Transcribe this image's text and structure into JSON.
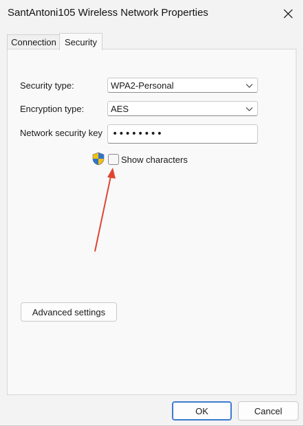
{
  "window": {
    "title": "SantAntoni105 Wireless Network Properties",
    "close_icon": "close-icon"
  },
  "tabs": [
    {
      "label": "Connection",
      "active": false
    },
    {
      "label": "Security",
      "active": true
    }
  ],
  "security": {
    "security_type_label": "Security type:",
    "security_type_value": "WPA2-Personal",
    "encryption_type_label": "Encryption type:",
    "encryption_type_value": "AES",
    "network_key_label": "Network security key",
    "network_key_value": "••••••••",
    "show_characters_label": "Show characters",
    "show_characters_checked": false,
    "shield_icon": "uac-shield-icon",
    "advanced_settings_label": "Advanced settings"
  },
  "footer": {
    "ok_label": "OK",
    "cancel_label": "Cancel"
  },
  "colors": {
    "annotation_arrow": "#e0452f",
    "primary_border": "#3a7ad1"
  }
}
